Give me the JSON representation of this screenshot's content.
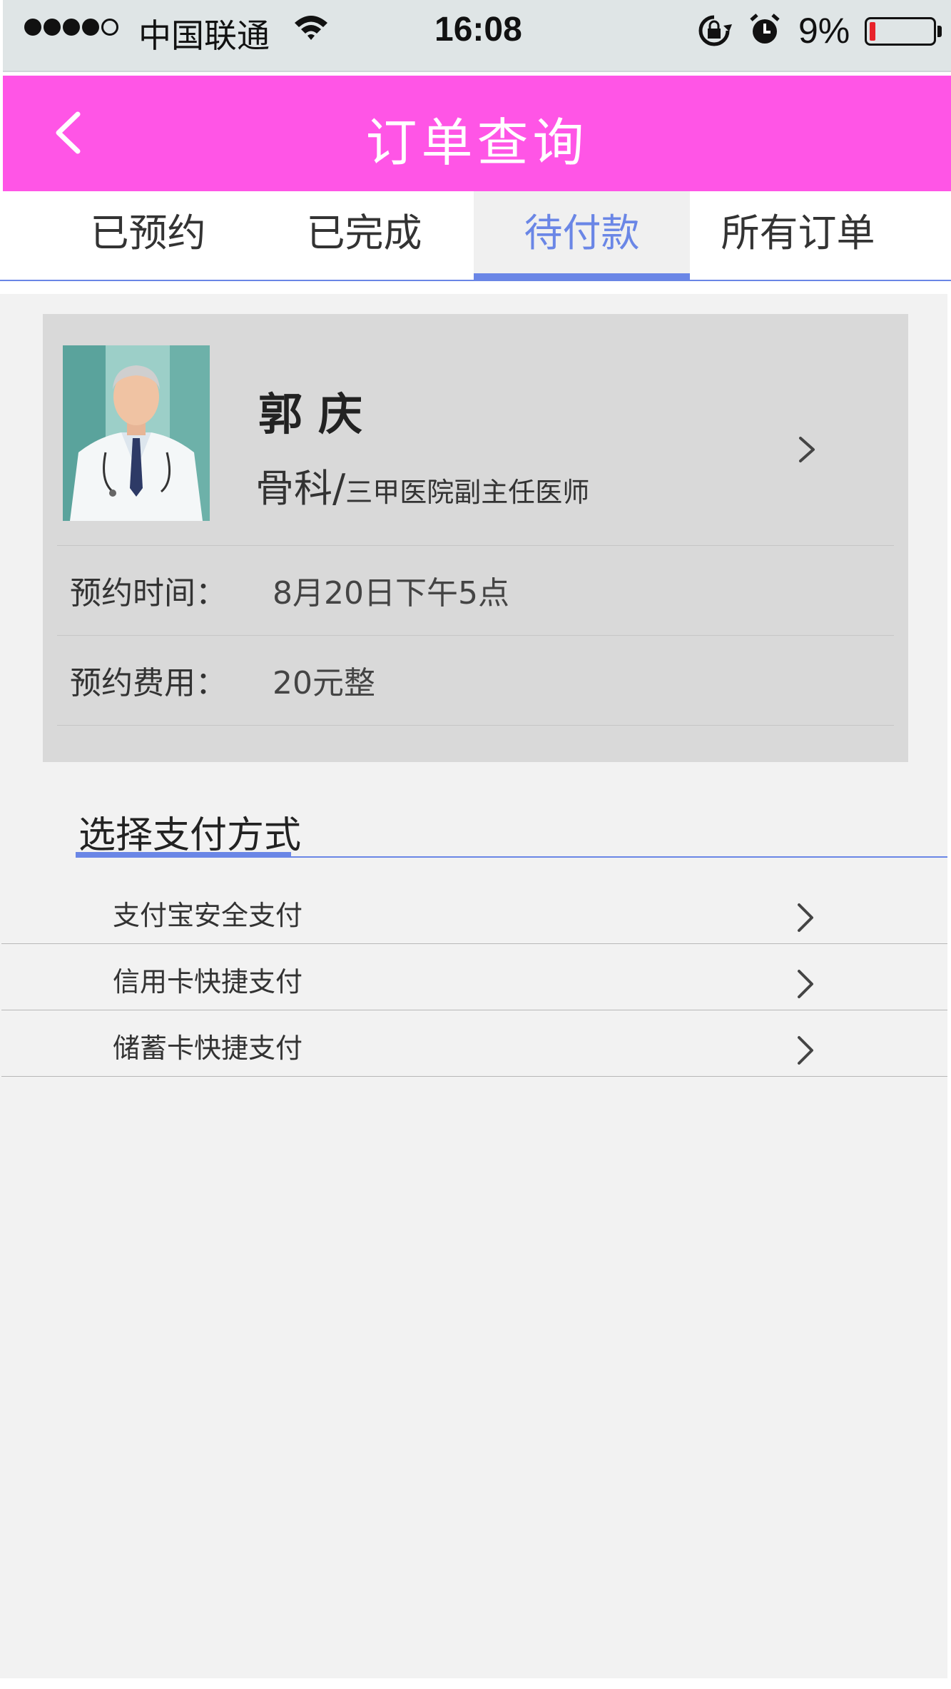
{
  "status_bar": {
    "carrier": "中国联通",
    "time": "16:08",
    "battery_percent": "9%",
    "signal_icon": "signal-dots-icon",
    "wifi_icon": "wifi-icon",
    "lock_icon": "rotation-lock-icon",
    "alarm_icon": "alarm-icon",
    "battery_icon": "battery-icon",
    "battery_level": 0.09,
    "battery_color": "#e8222a"
  },
  "header": {
    "title": "订单查询",
    "back_icon": "back-chevron-icon",
    "background": "#ff55e6"
  },
  "tabs": [
    {
      "label": "已预约",
      "active": false
    },
    {
      "label": "已完成",
      "active": false
    },
    {
      "label": "待付款",
      "active": true
    },
    {
      "label": "所有订单",
      "active": false
    }
  ],
  "accent_color": "#6a86e6",
  "order": {
    "doctor_name": "郭庆",
    "department": "骨科/",
    "doctor_title": "三甲医院副主任医师",
    "avatar_icon": "doctor-photo",
    "rows": [
      {
        "label": "预约时间：",
        "value": "8月20日下午5点"
      },
      {
        "label": "预约费用：",
        "value": "20元整"
      }
    ]
  },
  "payment": {
    "heading": "选择支付方式",
    "methods": [
      {
        "label": "支付宝安全支付"
      },
      {
        "label": "信用卡快捷支付"
      },
      {
        "label": "储蓄卡快捷支付"
      }
    ]
  }
}
